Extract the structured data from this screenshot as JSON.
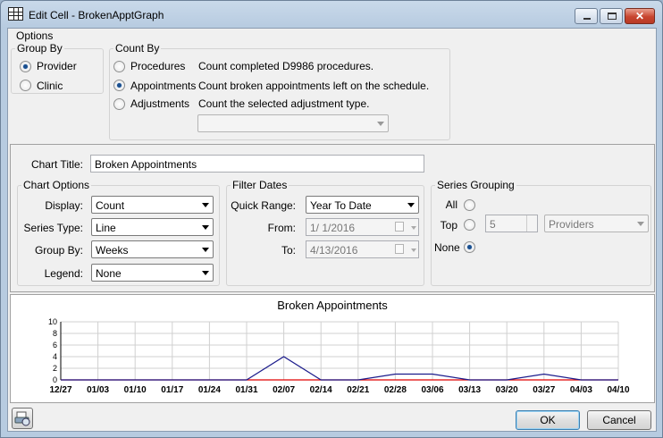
{
  "window": {
    "title": "Edit Cell - BrokenApptGraph",
    "close_symbol": "✕"
  },
  "options_label": "Options",
  "group_by": {
    "legend": "Group By",
    "options": [
      {
        "label": "Provider",
        "selected": true
      },
      {
        "label": "Clinic",
        "selected": false
      }
    ]
  },
  "count_by": {
    "legend": "Count By",
    "options": [
      {
        "label": "Procedures",
        "description": "Count completed D9986 procedures.",
        "selected": false
      },
      {
        "label": "Appointments",
        "description": "Count broken appointments left on the schedule.",
        "selected": true
      },
      {
        "label": "Adjustments",
        "description": "Count the selected adjustment type.",
        "selected": false
      }
    ],
    "adjustment_type_value": ""
  },
  "chart_title_label": "Chart Title:",
  "chart_title_value": "Broken Appointments",
  "chart_options": {
    "legend": "Chart Options",
    "display_label": "Display:",
    "display_value": "Count",
    "series_type_label": "Series Type:",
    "series_type_value": "Line",
    "group_by_label": "Group By:",
    "group_by_value": "Weeks",
    "legend_label": "Legend:",
    "legend_value": "None"
  },
  "filter_dates": {
    "legend": "Filter Dates",
    "quick_range_label": "Quick Range:",
    "quick_range_value": "Year To Date",
    "from_label": "From:",
    "from_value": "1/  1/2016",
    "to_label": "To:",
    "to_value": "4/13/2016"
  },
  "series_grouping": {
    "legend": "Series Grouping",
    "all_label": "All",
    "all_selected": false,
    "top_label": "Top",
    "top_selected": false,
    "top_count": "5",
    "top_of": "Providers",
    "none_label": "None",
    "none_selected": true
  },
  "chart_data": {
    "type": "line",
    "title": "Broken Appointments",
    "categories": [
      "12/27",
      "01/03",
      "01/10",
      "01/17",
      "01/24",
      "01/31",
      "02/07",
      "02/14",
      "02/21",
      "02/28",
      "03/06",
      "03/13",
      "03/20",
      "03/27",
      "04/03",
      "04/10"
    ],
    "yticks": [
      "10",
      "8",
      "6",
      "4",
      "2",
      "0"
    ],
    "ylim": [
      0,
      10
    ],
    "grid": true,
    "legend": "none",
    "series": [
      {
        "color": "#1c1c8c",
        "values": [
          0,
          0,
          0,
          0,
          0,
          0,
          4,
          0,
          0,
          1,
          1,
          0,
          0,
          1,
          0,
          0
        ]
      },
      {
        "color": "#e00000",
        "values": [
          0,
          0,
          0,
          0,
          0,
          0,
          0,
          0,
          0,
          0,
          0,
          0,
          0,
          0,
          0,
          0
        ]
      }
    ]
  },
  "buttons": {
    "ok": "OK",
    "cancel": "Cancel"
  },
  "icons": {
    "title": "grid-icon",
    "setup": "printer-setup-icon"
  }
}
